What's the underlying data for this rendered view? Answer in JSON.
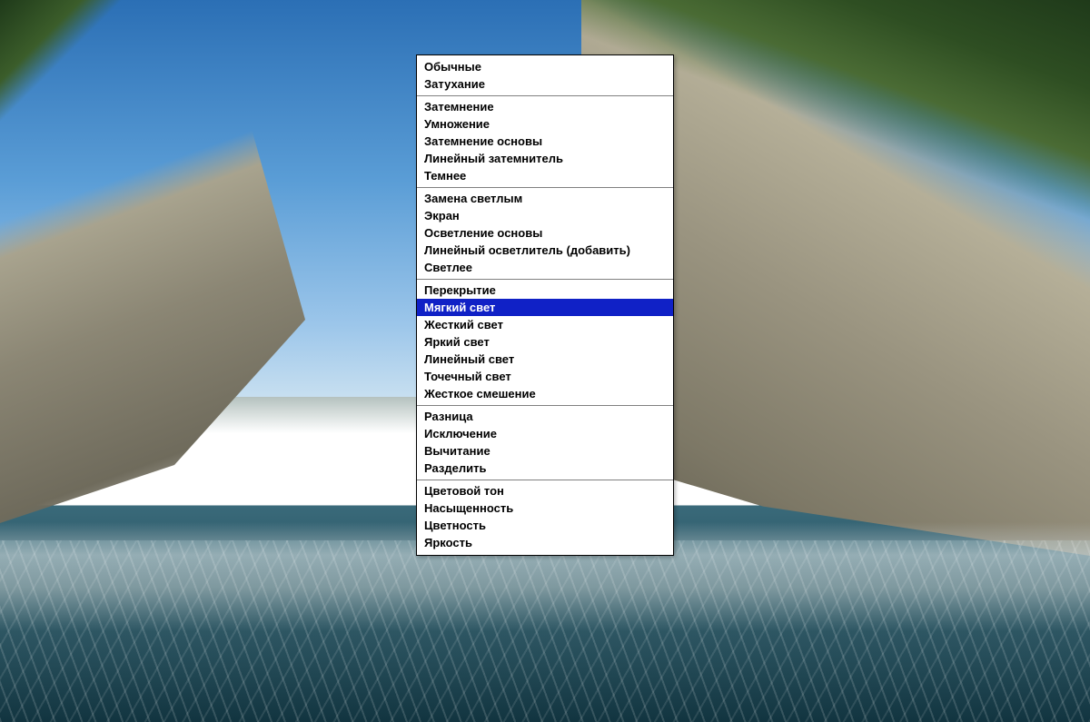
{
  "menu": {
    "selected": "Мягкий свет",
    "groups": [
      {
        "items": [
          "Обычные",
          "Затухание"
        ]
      },
      {
        "items": [
          "Затемнение",
          "Умножение",
          "Затемнение основы",
          "Линейный затемнитель",
          "Темнее"
        ]
      },
      {
        "items": [
          "Замена светлым",
          "Экран",
          "Осветление основы",
          "Линейный осветлитель (добавить)",
          "Светлее"
        ]
      },
      {
        "items": [
          "Перекрытие",
          "Мягкий свет",
          "Жесткий свет",
          "Яркий свет",
          "Линейный свет",
          "Точечный свет",
          "Жесткое смешение"
        ]
      },
      {
        "items": [
          "Разница",
          "Исключение",
          "Вычитание",
          "Разделить"
        ]
      },
      {
        "items": [
          "Цветовой тон",
          "Насыщенность",
          "Цветность",
          "Яркость"
        ]
      }
    ]
  }
}
